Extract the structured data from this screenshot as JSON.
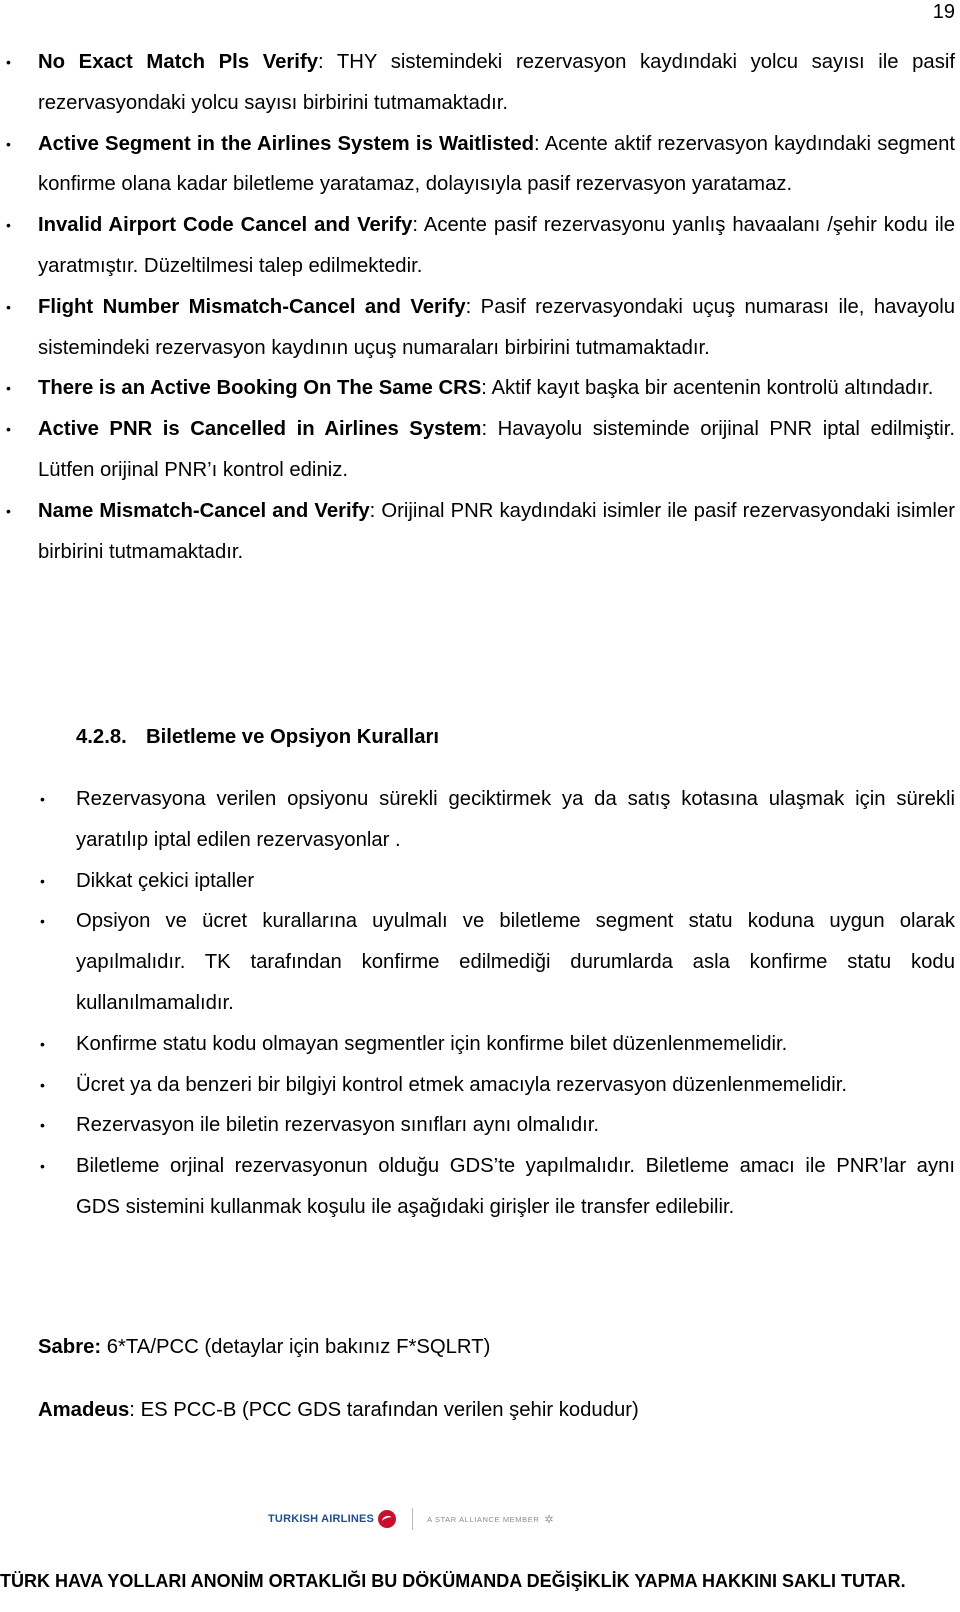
{
  "page_number": "19",
  "error_list": [
    {
      "term": "No Exact Match Pls Verify",
      "description": ": THY sistemindeki rezervasyon kaydındaki yolcu sayısı ile pasif rezervasyondaki yolcu sayısı birbirini tutmamaktadır."
    },
    {
      "term": "Active Segment in the Airlines System is Waitlisted",
      "description": ": Acente aktif rezervasyon kaydındaki segment konfirme olana kadar biletleme yaratamaz, dolayısıyla pasif rezervasyon yaratamaz."
    },
    {
      "term": "Invalid Airport Code Cancel and Verify",
      "description": ": Acente pasif rezervasyonu yanlış havaalanı /şehir kodu ile yaratmıştır. Düzeltilmesi talep edilmektedir."
    },
    {
      "term": "Flight Number Mismatch-Cancel and Verify",
      "description": ": Pasif rezervasyondaki uçuş numarası ile, havayolu sistemindeki rezervasyon kaydının uçuş numaraları birbirini tutmamaktadır."
    },
    {
      "term": "There is an Active Booking On The Same CRS",
      "description": ": Aktif kayıt başka bir acentenin kontrolü altındadır."
    },
    {
      "term": "Active PNR is Cancelled in Airlines System",
      "description": ": Havayolu sisteminde orijinal PNR iptal edilmiştir. Lütfen orijinal PNR’ı kontrol ediniz."
    },
    {
      "term": "Name Mismatch-Cancel and Verify",
      "description": ": Orijinal PNR kaydındaki isimler ile pasif rezervasyondaki isimler birbirini tutmamaktadır."
    }
  ],
  "section": {
    "number": "4.2.8.",
    "title": "Biletleme ve Opsiyon Kuralları"
  },
  "rules_list": [
    "Rezervasyona verilen opsiyonu sürekli geciktirmek ya da satış kotasına ulaşmak için sürekli yaratılıp iptal edilen rezervasyonlar .",
    "Dikkat çekici iptaller",
    "Opsiyon ve ücret kurallarına uyulmalı ve biletleme segment statu koduna uygun olarak yapılmalıdır. TK tarafından konfirme edilmediği durumlarda asla konfirme statu kodu kullanılmamalıdır.",
    "Konfirme statu kodu olmayan segmentler için konfirme bilet düzenlenmemelidir.",
    "Ücret ya da benzeri bir bilgiyi kontrol etmek amacıyla rezervasyon düzenlenmemelidir.",
    "Rezervasyon ile biletin rezervasyon sınıfları aynı olmalıdır.",
    "Biletleme orjinal rezervasyonun olduğu GDS’te yapılmalıdır. Biletleme amacı ile PNR’lar aynı GDS sistemini kullanmak koşulu ile aşağıdaki girişler ile transfer edilebilir."
  ],
  "gds_entries": {
    "sabre": {
      "label": "Sabre:",
      "value": " 6*TA/PCC (detaylar için bakınız F*SQLRT)"
    },
    "amadeus": {
      "label": "Amadeus",
      "value": ": ES PCC-B (PCC GDS tarafından verilen şehir kodudur)"
    }
  },
  "logo": {
    "brand": "TURKISH AIRLINES",
    "alliance": "A STAR ALLIANCE MEMBER",
    "brand_color": "#1f4e8c",
    "emblem_color": "#c8102e"
  },
  "footer": {
    "notice": "TÜRK HAVA YOLLARI ANONİM ORTAKLIĞI BU DÖKÜMANDA DEĞİŞİKLİK YAPMA HAKKINI SAKLI TUTAR."
  },
  "icons": {
    "bullet": "•",
    "star_alliance": "✲"
  }
}
